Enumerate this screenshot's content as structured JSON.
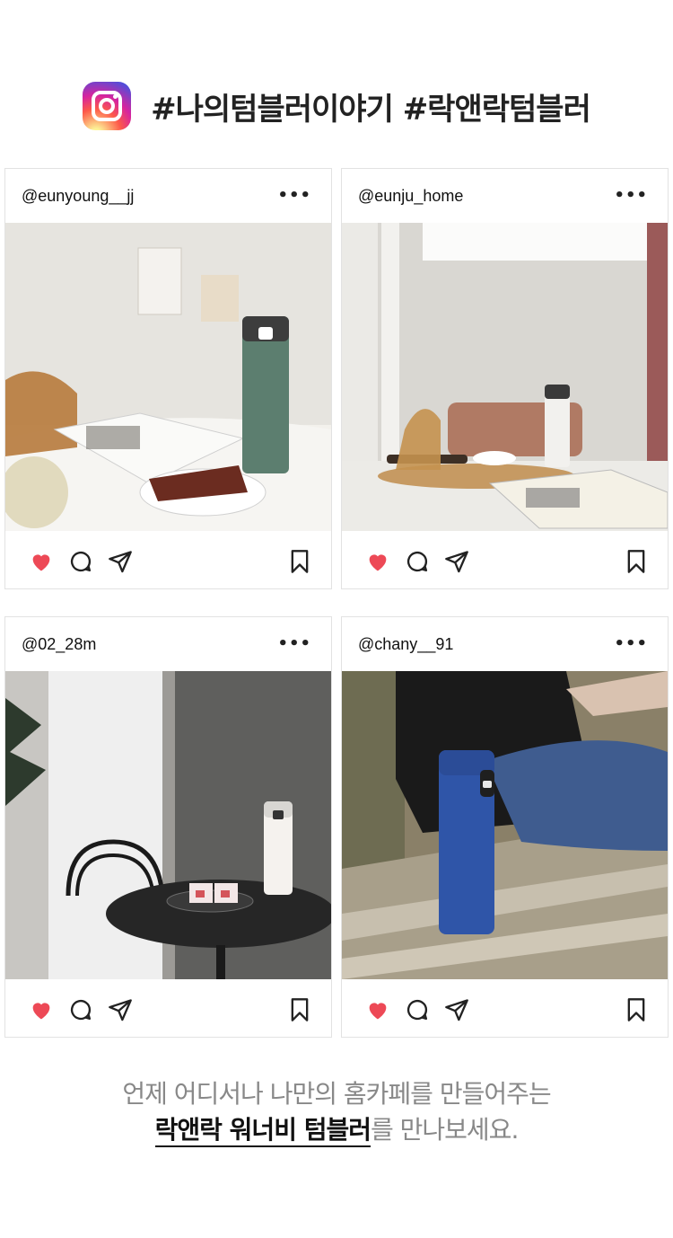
{
  "header": {
    "icon": "instagram-icon",
    "hashtags": "#나의텀블러이야기 #락앤락텀블러"
  },
  "posts": [
    {
      "username": "@eunyoung__jj",
      "liked": true
    },
    {
      "username": "@eunju_home",
      "liked": true
    },
    {
      "username": "@02_28m",
      "liked": true
    },
    {
      "username": "@chany__91",
      "liked": true
    }
  ],
  "footer": {
    "line1": "언제 어디서나 나만의 홈카페를 만들어주는",
    "line2_emphasis": "락앤락 워너비 텀블러",
    "line2_rest": "를 만나보세요."
  },
  "colors": {
    "like": "#ed4956",
    "icon": "#222222"
  }
}
